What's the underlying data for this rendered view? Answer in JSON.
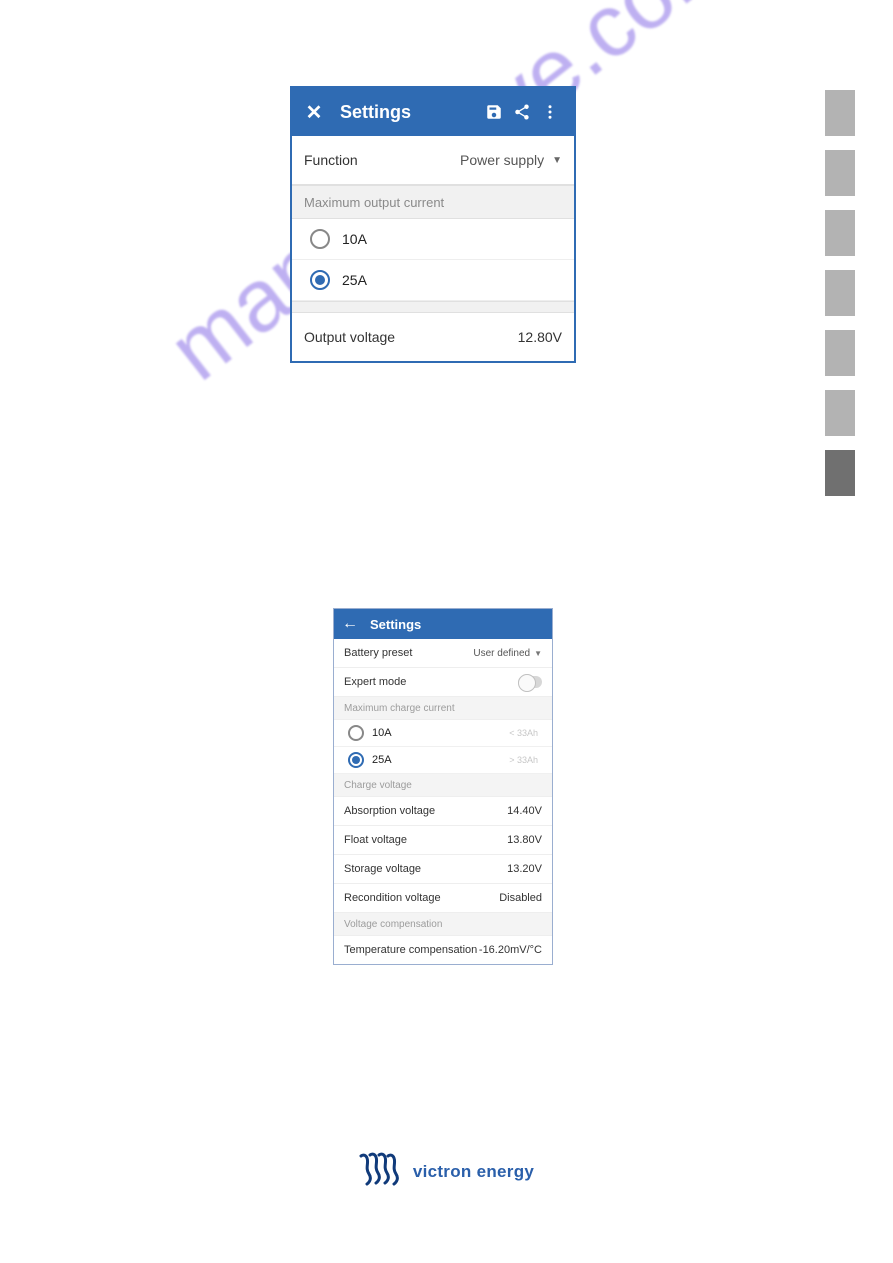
{
  "watermark": "manualshive.com",
  "shot1": {
    "title": "Settings",
    "function_label": "Function",
    "function_value": "Power supply",
    "max_current_header": "Maximum output current",
    "options": [
      {
        "label": "10A",
        "selected": false
      },
      {
        "label": "25A",
        "selected": true
      }
    ],
    "output_voltage_label": "Output voltage",
    "output_voltage_value": "12.80V"
  },
  "shot2": {
    "title": "Settings",
    "battery_preset_label": "Battery preset",
    "battery_preset_value": "User defined",
    "expert_mode_label": "Expert mode",
    "max_charge_header": "Maximum charge current",
    "charge_options": [
      {
        "label": "10A",
        "hint": "< 33Ah",
        "selected": false
      },
      {
        "label": "25A",
        "hint": "> 33Ah",
        "selected": true
      }
    ],
    "charge_voltage_header": "Charge voltage",
    "rows": [
      {
        "label": "Absorption voltage",
        "value": "14.40V"
      },
      {
        "label": "Float voltage",
        "value": "13.80V"
      },
      {
        "label": "Storage voltage",
        "value": "13.20V"
      },
      {
        "label": "Recondition voltage",
        "value": "Disabled"
      }
    ],
    "voltage_comp_header": "Voltage compensation",
    "temp_comp_label": "Temperature compensation",
    "temp_comp_value": "-16.20mV/°C"
  },
  "footer": {
    "brand": "victron energy"
  }
}
